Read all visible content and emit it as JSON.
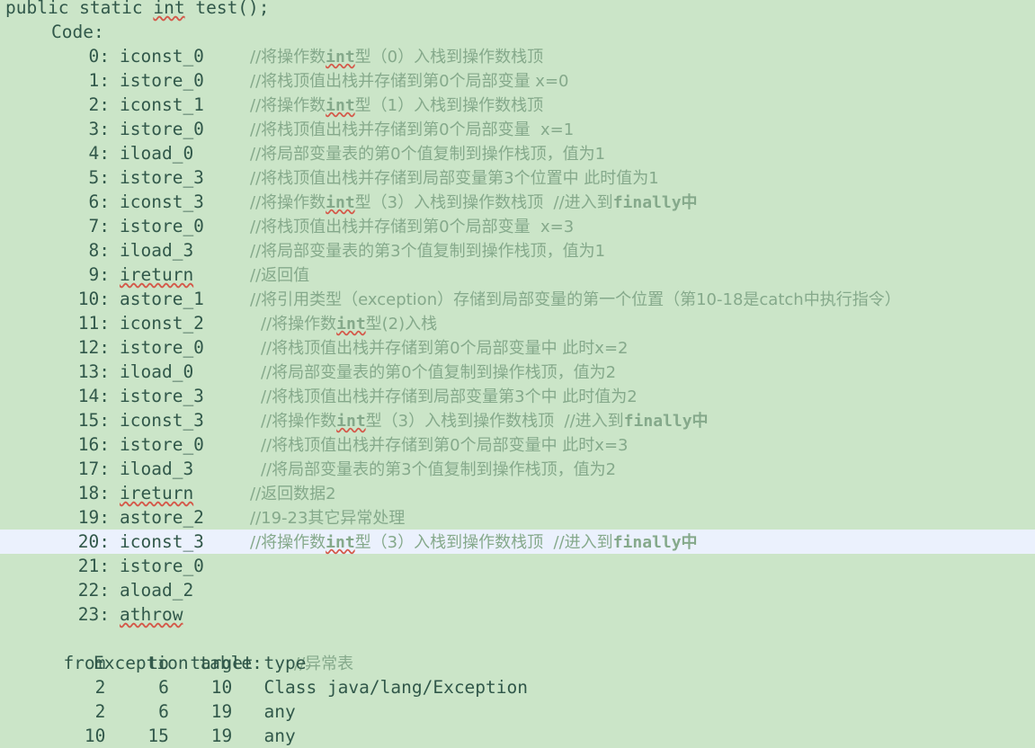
{
  "document": {
    "kind": "javap-bytecode-listing",
    "signature": "public static int test();",
    "signature_misspelled_token": "int",
    "code_label": "Code:",
    "background_color": "#cbe5c8",
    "text_color": "#31584a",
    "comment_color": "#85a98b",
    "highlight_color": "#ebf1fd",
    "highlighted_index": 20
  },
  "instructions": [
    {
      "index": "0",
      "opcode": "iconst_0",
      "squiggle": false,
      "comment_pre": "//将操作数",
      "comment_mono": "int",
      "comment_post": "型（0）入栈到操作数栈顶",
      "comment_extra": "",
      "indent": 1
    },
    {
      "index": "1",
      "opcode": "istore_0",
      "squiggle": false,
      "comment_pre": "//将栈顶值出栈并存储到第0个局部变量 x=0",
      "comment_mono": "",
      "comment_post": "",
      "comment_extra": "",
      "indent": 1
    },
    {
      "index": "2",
      "opcode": "iconst_1",
      "squiggle": false,
      "comment_pre": "//将操作数",
      "comment_mono": "int",
      "comment_post": "型（1）入栈到操作数栈顶",
      "comment_extra": "",
      "indent": 1
    },
    {
      "index": "3",
      "opcode": "istore_0",
      "squiggle": false,
      "comment_pre": "//将栈顶值出栈并存储到第0个局部变量  x=1",
      "comment_mono": "",
      "comment_post": "",
      "comment_extra": "",
      "indent": 1
    },
    {
      "index": "4",
      "opcode": "iload_0",
      "squiggle": false,
      "comment_pre": "//将局部变量表的第0个值复制到操作栈顶，值为1",
      "comment_mono": "",
      "comment_post": "",
      "comment_extra": "",
      "indent": 1
    },
    {
      "index": "5",
      "opcode": "istore_3",
      "squiggle": false,
      "comment_pre": "//将栈顶值出栈并存储到局部变量第3个位置中 此时值为1",
      "comment_mono": "",
      "comment_post": "",
      "comment_extra": "",
      "indent": 1
    },
    {
      "index": "6",
      "opcode": "iconst_3",
      "squiggle": false,
      "comment_pre": "//将操作数",
      "comment_mono": "int",
      "comment_post": "型（3）入栈到操作数栈顶  //进入到",
      "comment_extra": "finally中",
      "indent": 1
    },
    {
      "index": "7",
      "opcode": "istore_0",
      "squiggle": false,
      "comment_pre": "//将栈顶值出栈并存储到第0个局部变量  x=3",
      "comment_mono": "",
      "comment_post": "",
      "comment_extra": "",
      "indent": 1
    },
    {
      "index": "8",
      "opcode": "iload_3",
      "squiggle": false,
      "comment_pre": "//将局部变量表的第3个值复制到操作栈顶，值为1",
      "comment_mono": "",
      "comment_post": "",
      "comment_extra": "",
      "indent": 1
    },
    {
      "index": "9",
      "opcode": "ireturn",
      "squiggle": true,
      "comment_pre": "//返回值",
      "comment_mono": "",
      "comment_post": "",
      "comment_extra": "",
      "indent": 1
    },
    {
      "index": "10",
      "opcode": "astore_1",
      "squiggle": false,
      "comment_pre": "//将引用类型（exception）存储到局部变量的第一个位置（第10-18是catch中执行指令）",
      "comment_mono": "",
      "comment_post": "",
      "comment_extra": "",
      "indent": 1
    },
    {
      "index": "11",
      "opcode": "iconst_2",
      "squiggle": false,
      "comment_pre": "//将操作数",
      "comment_mono": "int",
      "comment_post": "型(2)入栈",
      "comment_extra": "",
      "indent": 2
    },
    {
      "index": "12",
      "opcode": "istore_0",
      "squiggle": false,
      "comment_pre": "//将栈顶值出栈并存储到第0个局部变量中 此时x=2",
      "comment_mono": "",
      "comment_post": "",
      "comment_extra": "",
      "indent": 2
    },
    {
      "index": "13",
      "opcode": "iload_0",
      "squiggle": false,
      "comment_pre": "//将局部变量表的第0个值复制到操作栈顶，值为2",
      "comment_mono": "",
      "comment_post": "",
      "comment_extra": "",
      "indent": 2
    },
    {
      "index": "14",
      "opcode": "istore_3",
      "squiggle": false,
      "comment_pre": "//将栈顶值出栈并存储到局部变量第3个中 此时值为2",
      "comment_mono": "",
      "comment_post": "",
      "comment_extra": "",
      "indent": 2
    },
    {
      "index": "15",
      "opcode": "iconst_3",
      "squiggle": false,
      "comment_pre": "//将操作数",
      "comment_mono": "int",
      "comment_post": "型（3）入栈到操作数栈顶  //进入到",
      "comment_extra": "finally中",
      "indent": 2
    },
    {
      "index": "16",
      "opcode": "istore_0",
      "squiggle": false,
      "comment_pre": "//将栈顶值出栈并存储到第0个局部变量中 此时x=3",
      "comment_mono": "",
      "comment_post": "",
      "comment_extra": "",
      "indent": 2
    },
    {
      "index": "17",
      "opcode": "iload_3",
      "squiggle": false,
      "comment_pre": "//将局部变量表的第3个值复制到操作栈顶，值为2",
      "comment_mono": "",
      "comment_post": "",
      "comment_extra": "",
      "indent": 2
    },
    {
      "index": "18",
      "opcode": "ireturn",
      "squiggle": true,
      "comment_pre": "//返回数据2",
      "comment_mono": "",
      "comment_post": "",
      "comment_extra": "",
      "indent": 1
    },
    {
      "index": "19",
      "opcode": "astore_2",
      "squiggle": false,
      "comment_pre": "//19-23其它异常处理",
      "comment_mono": "",
      "comment_post": "",
      "comment_extra": "",
      "indent": 1
    },
    {
      "index": "20",
      "opcode": "iconst_3",
      "squiggle": false,
      "comment_pre": "//将操作数",
      "comment_mono": "int",
      "comment_post": "型（3）入栈到操作数栈顶  //进入到",
      "comment_extra": "finally中",
      "indent": 1
    },
    {
      "index": "21",
      "opcode": "istore_0",
      "squiggle": false,
      "comment_pre": "",
      "comment_mono": "",
      "comment_post": "",
      "comment_extra": "",
      "indent": 1
    },
    {
      "index": "22",
      "opcode": "aload_2",
      "squiggle": false,
      "comment_pre": "",
      "comment_mono": "",
      "comment_post": "",
      "comment_extra": "",
      "indent": 1
    },
    {
      "index": "23",
      "opcode": "athrow",
      "squiggle": true,
      "comment_pre": "",
      "comment_mono": "",
      "comment_post": "",
      "comment_extra": "",
      "indent": 1
    }
  ],
  "exception_table": {
    "title": "Exception table:",
    "title_comment": "//异常表",
    "headers": [
      "from",
      "to",
      "target",
      "type"
    ],
    "header_line": "      from    to  target type",
    "rows": [
      {
        "line": "         2     6    10   Class java/lang/Exception",
        "from": "2",
        "to": "6",
        "target": "10",
        "type": "Class java/lang/Exception"
      },
      {
        "line": "         2     6    19   any",
        "from": "2",
        "to": "6",
        "target": "19",
        "type": "any"
      },
      {
        "line": "        10    15    19   any",
        "from": "10",
        "to": "15",
        "target": "19",
        "type": "any"
      }
    ]
  }
}
